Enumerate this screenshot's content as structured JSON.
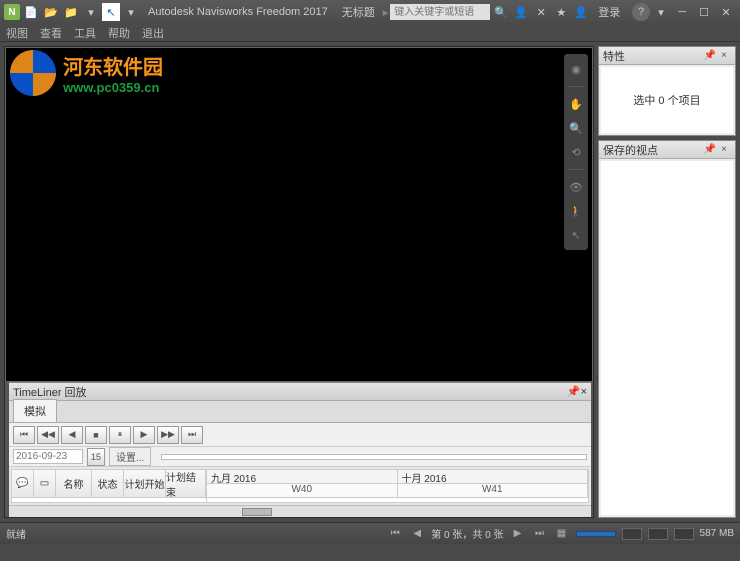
{
  "titlebar": {
    "app_name": "Autodesk Navisworks Freedom 2017",
    "doc_title": "无标题",
    "search_placeholder": "键入关键字或短语",
    "login_label": "登录"
  },
  "menubar": {
    "items": [
      "视图",
      "查看",
      "工具",
      "帮助",
      "退出"
    ]
  },
  "watermark": {
    "line1": "河东软件园",
    "line2": "www.pc0359.cn"
  },
  "panels": {
    "properties": {
      "title": "特性",
      "empty_text": "选中 0 个项目"
    },
    "saved_views": {
      "title": "保存的视点"
    }
  },
  "timeliner": {
    "title": "TimeLiner 回放",
    "tab_simulate": "模拟",
    "date": "2016-09-23",
    "day": "15",
    "settings_label": "设置...",
    "columns": [
      "",
      "",
      "名称",
      "状态",
      "计划开始",
      "计划结束"
    ],
    "months": [
      "九月 2016",
      "十月 2016"
    ],
    "weeks": [
      "W40",
      "W41"
    ]
  },
  "statusbar": {
    "ready": "就绪",
    "sheet_info": "第 0 张，共 0 张",
    "mem": "587 MB"
  }
}
